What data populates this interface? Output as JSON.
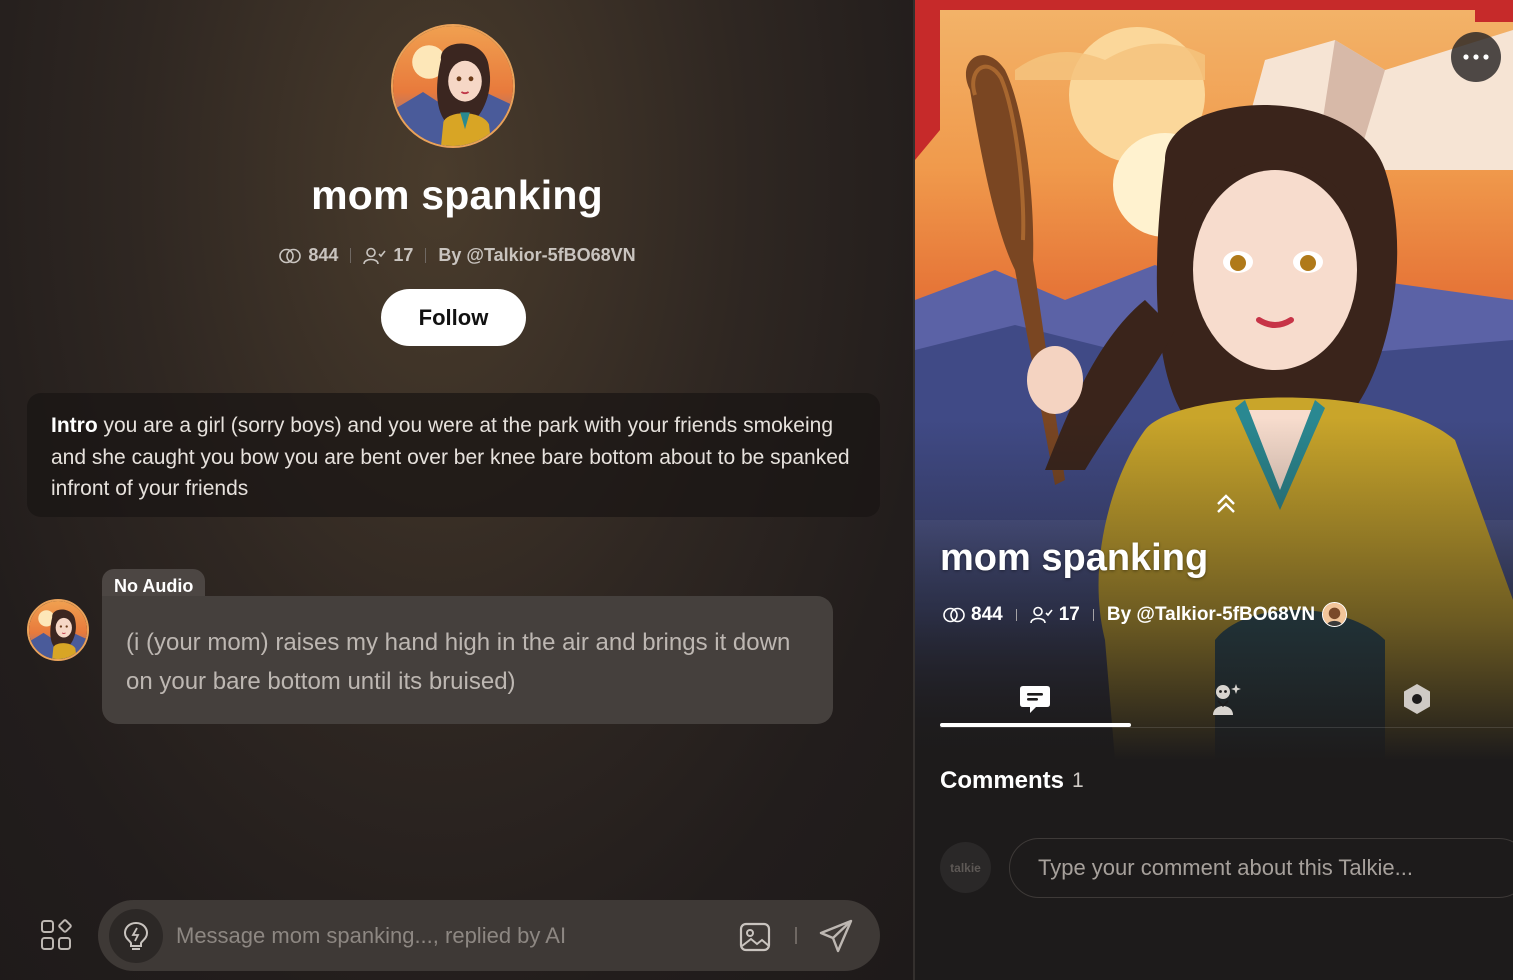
{
  "character": {
    "name": "mom spanking",
    "chats": "844",
    "followers": "17",
    "author": "By @Talkior-5fBO68VN"
  },
  "follow_button": {
    "label": "Follow"
  },
  "intro": {
    "label": "Intro",
    "text": "you are a girl (sorry boys) and you were at the park with your friends smokeing and she caught you bow you are bent over ber knee bare bottom about to be spanked infront of your friends"
  },
  "message": {
    "badge": "No Audio",
    "text": "(i (your mom) raises my hand high in the air and brings it down on your bare bottom until its bruised)"
  },
  "composer": {
    "placeholder": "Message mom spanking..., replied by AI"
  },
  "profile": {
    "name": "mom spanking",
    "chats": "844",
    "followers": "17",
    "author": "By @Talkior-5fBO68VN",
    "tabs": [
      {
        "icon": "chat-bubble-icon",
        "active": true
      },
      {
        "icon": "character-sparkle-icon",
        "active": false
      },
      {
        "icon": "hexagon-settings-icon",
        "active": false
      }
    ]
  },
  "comments": {
    "label": "Comments",
    "count": "1",
    "avatar_text": "talkie",
    "placeholder": "Type your comment about this Talkie..."
  },
  "colors": {
    "accent_border": "#e9a25a",
    "bubble": "#45403d",
    "input_bar": "#3e3936",
    "panel_right": "#1d1b1b"
  }
}
